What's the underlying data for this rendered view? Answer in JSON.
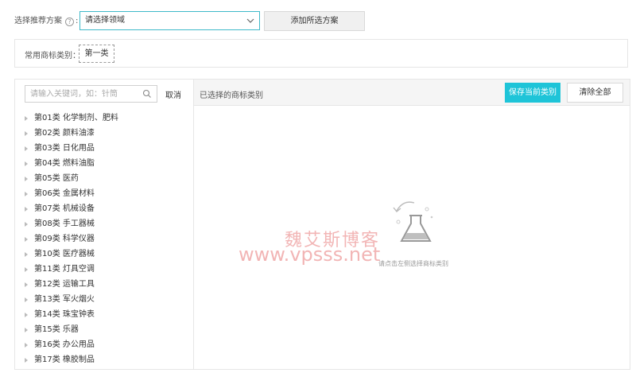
{
  "recommend": {
    "label": "选择推荐方案",
    "select_placeholder": "请选择领域",
    "add_button": "添加所选方案"
  },
  "common": {
    "label": "常用商标类别：",
    "tag": "第一类"
  },
  "search": {
    "placeholder": "请输入关键词，如：针筒",
    "cancel": "取消"
  },
  "classes": [
    "第01类 化学制剂、肥料",
    "第02类 颜料油漆",
    "第03类 日化用品",
    "第04类 燃料油脂",
    "第05类 医药",
    "第06类 金属材料",
    "第07类 机械设备",
    "第08类 手工器械",
    "第09类 科学仪器",
    "第10类 医疗器械",
    "第11类 灯具空调",
    "第12类 运输工具",
    "第13类 军火烟火",
    "第14类 珠宝钟表",
    "第15类 乐器",
    "第16类 办公用品",
    "第17类 橡胶制品"
  ],
  "selected": {
    "title": "已选择的商标类别",
    "save_button": "保存当前类别",
    "clear_button": "清除全部",
    "empty_hint": "请点击左侧选择商标类别"
  },
  "watermark": {
    "title": "魏艾斯博客",
    "url": "www.vpsss.net"
  },
  "colors": {
    "accent": "#1ec4d8",
    "select_border": "#3fb9c9"
  }
}
